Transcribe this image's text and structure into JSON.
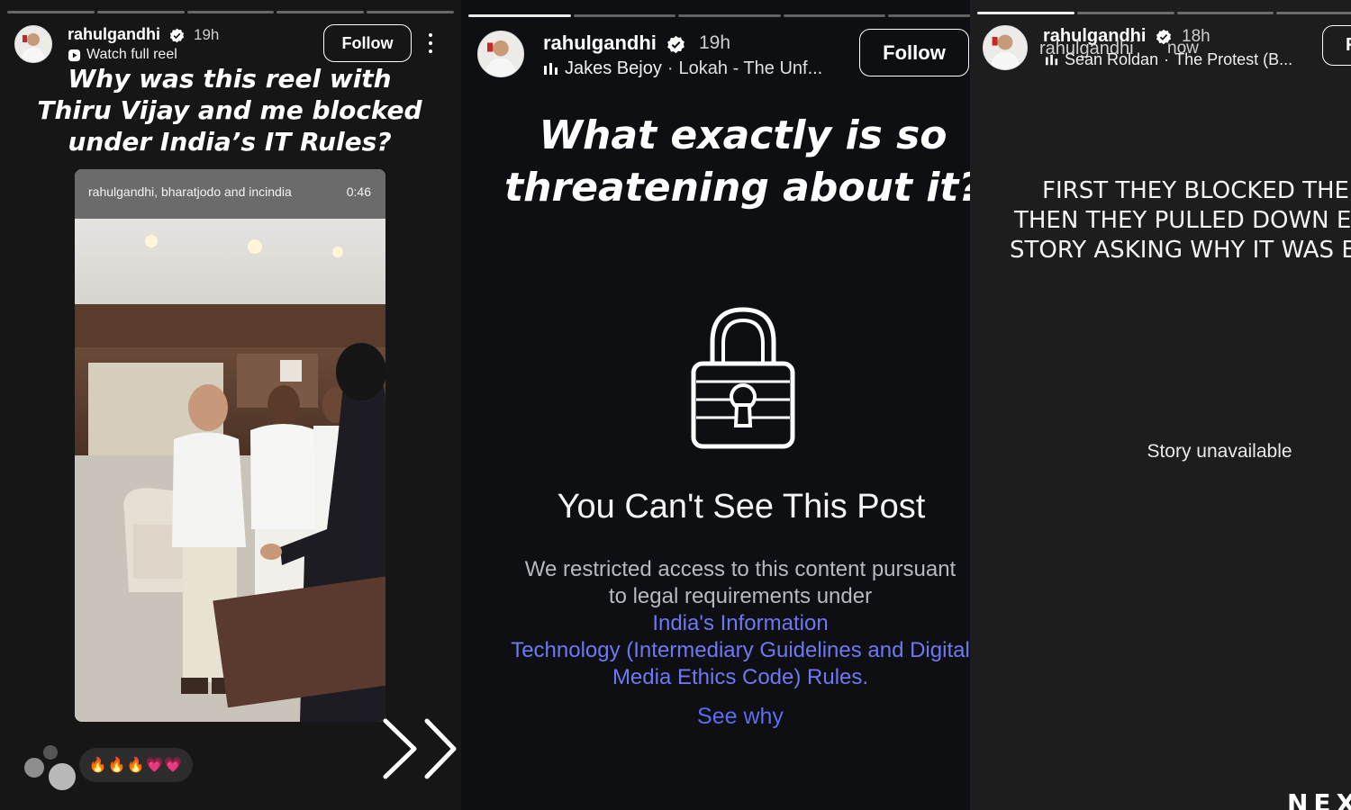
{
  "left_story": {
    "username": "rahulgandhi",
    "time": "19h",
    "sub_label": "Watch full reel",
    "follow_label": "Follow",
    "headline": [
      "Why was this reel with",
      "Thiru Vijay and me blocked",
      "under India’s IT Rules?"
    ],
    "video": {
      "accounts": "rahulgandhi, bharatjodo and incindia",
      "duration": "0:46"
    },
    "reactions": "🔥🔥🔥💗💗",
    "progress_done": 0,
    "progress_segments": 5
  },
  "middle_story": {
    "username": "rahulgandhi",
    "time": "19h",
    "music_artist": "Jakes Bejoy",
    "music_track": "Lokah - The Unf...",
    "follow_label": "Follow",
    "headline": [
      "What exactly is so",
      "threatening about it?"
    ],
    "notice_title": "You Can't See This Post",
    "notice_lines": [
      [
        "We restricted access to this content pursuant",
        ""
      ],
      [
        "to legal requirements under ",
        "India's Information"
      ],
      [
        "",
        "Technology (Intermediary Guidelines and Digital"
      ],
      [
        "",
        "Media Ethics Code) Rules."
      ]
    ],
    "see_why": "See why",
    "progress_done": 1,
    "progress_segments": 5
  },
  "right_story": {
    "username": "rahulgandhi",
    "time": "18h",
    "overlay_username": "rahulgandhi",
    "overlay_time": "now",
    "music_artist": "Sean Roldan",
    "music_track": "The Protest (B...",
    "follow_label": "F",
    "headline": [
      "FIRST THEY BLOCKED THE REEL",
      "THEN THEY PULLED DOWN EVEN THE",
      "STORY ASKING WHY IT WAS BLOCKED"
    ],
    "status": "Story unavailable",
    "corner_mark": "NEX",
    "progress_done": 1,
    "progress_segments": 4
  },
  "colors": {
    "link_blue": "#6f78f2",
    "see_why_blue": "#5b6cf0",
    "card_bg": "#2c2c2c"
  }
}
